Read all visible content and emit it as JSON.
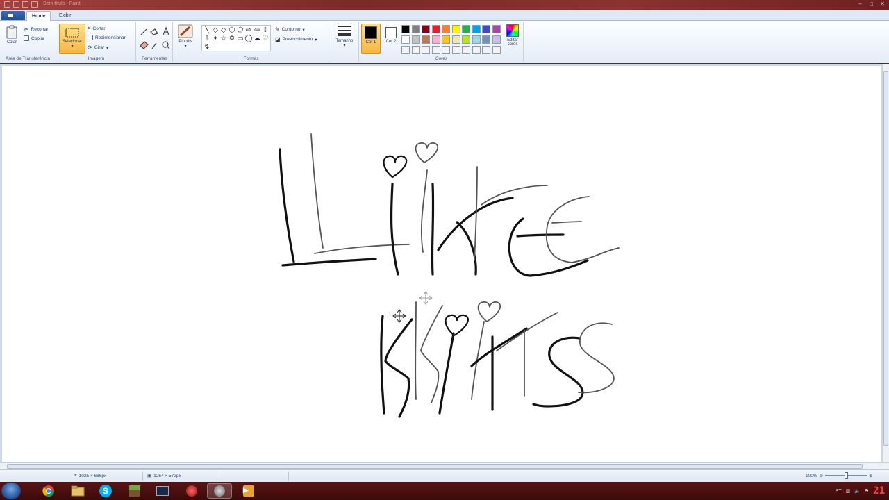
{
  "app": {
    "window_title": "Sem título - Paint"
  },
  "tabs": [
    {
      "label": "Home",
      "active": true
    },
    {
      "label": "Exibir",
      "active": false
    }
  ],
  "clipboard": {
    "paste_label": "Colar",
    "cut_label": "Recortar",
    "copy_label": "Copiar",
    "group_label": "Área de Transferência"
  },
  "image": {
    "select_label": "Selecionar",
    "crop_label": "Cortar",
    "resize_label": "Redimensionar",
    "rotate_label": "Girar",
    "group_label": "Imagem"
  },
  "tools": {
    "group_label": "Ferramentas",
    "brushes_label": "Pincéis"
  },
  "shapes": {
    "outline_label": "Contorno",
    "fill_label": "Preenchimento",
    "group_label": "Formas",
    "size_label": "Tamanho"
  },
  "colors": {
    "color1_label": "Cor 1",
    "color2_label": "Cor 2",
    "edit_label": "Editar cores",
    "group_label": "Cores",
    "color1": "#000000",
    "color2": "#ffffff",
    "palette_row1": [
      "#000000",
      "#7f7f7f",
      "#880015",
      "#ed1c24",
      "#ff7f27",
      "#fff200",
      "#22b14c",
      "#00a2e8",
      "#3f48cc",
      "#a349a4"
    ],
    "palette_row2": [
      "#ffffff",
      "#c3c3c3",
      "#b97a57",
      "#ffaec9",
      "#ffc90e",
      "#efe4b0",
      "#b5e61d",
      "#99d9ea",
      "#7092be",
      "#c8bfe7"
    ]
  },
  "drawing": {
    "stroke_color": "#111111",
    "light_stroke_color": "#555555"
  },
  "status": {
    "cursor_pos": "1025 × 686px",
    "canvas_size": "1264 × 572px",
    "zoom": "100%"
  },
  "taskbar": {
    "apps": [
      "chrome-icon",
      "explorer-icon",
      "skype-icon",
      "minecraft-icon",
      "terminal-icon",
      "app-red-icon",
      "app-gray-icon",
      "media-player-icon"
    ],
    "language": "PT",
    "clock": "21"
  }
}
